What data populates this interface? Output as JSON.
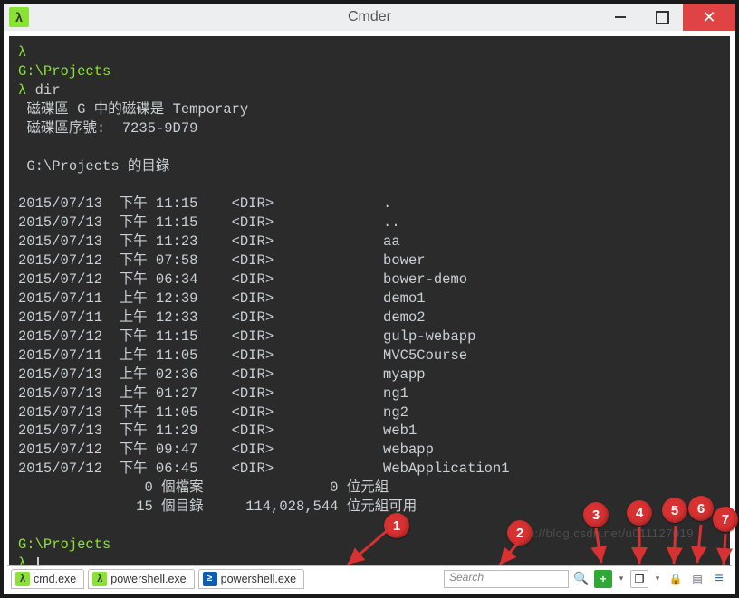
{
  "window": {
    "title": "Cmder"
  },
  "prompt": {
    "lambda": "λ",
    "path": "G:\\Projects",
    "cmd": "dir"
  },
  "vol": {
    "line1": "磁碟區 G 中的磁碟是 Temporary",
    "line2": "磁碟區序號:  7235-9D79"
  },
  "heading": "G:\\Projects 的目錄",
  "rows": [
    {
      "date": "2015/07/13",
      "time": "下午 11:15",
      "tag": "<DIR>",
      "name": "."
    },
    {
      "date": "2015/07/13",
      "time": "下午 11:15",
      "tag": "<DIR>",
      "name": ".."
    },
    {
      "date": "2015/07/13",
      "time": "下午 11:23",
      "tag": "<DIR>",
      "name": "aa"
    },
    {
      "date": "2015/07/12",
      "time": "下午 07:58",
      "tag": "<DIR>",
      "name": "bower"
    },
    {
      "date": "2015/07/12",
      "time": "下午 06:34",
      "tag": "<DIR>",
      "name": "bower-demo"
    },
    {
      "date": "2015/07/11",
      "time": "上午 12:39",
      "tag": "<DIR>",
      "name": "demo1"
    },
    {
      "date": "2015/07/11",
      "time": "上午 12:33",
      "tag": "<DIR>",
      "name": "demo2"
    },
    {
      "date": "2015/07/12",
      "time": "下午 11:15",
      "tag": "<DIR>",
      "name": "gulp-webapp"
    },
    {
      "date": "2015/07/11",
      "time": "上午 11:05",
      "tag": "<DIR>",
      "name": "MVC5Course"
    },
    {
      "date": "2015/07/13",
      "time": "上午 02:36",
      "tag": "<DIR>",
      "name": "myapp"
    },
    {
      "date": "2015/07/13",
      "time": "上午 01:27",
      "tag": "<DIR>",
      "name": "ng1"
    },
    {
      "date": "2015/07/13",
      "time": "下午 11:05",
      "tag": "<DIR>",
      "name": "ng2"
    },
    {
      "date": "2015/07/13",
      "time": "下午 11:29",
      "tag": "<DIR>",
      "name": "web1"
    },
    {
      "date": "2015/07/12",
      "time": "下午 09:47",
      "tag": "<DIR>",
      "name": "webapp"
    },
    {
      "date": "2015/07/12",
      "time": "下午 06:45",
      "tag": "<DIR>",
      "name": "WebApplication1"
    }
  ],
  "summary": {
    "files": "               0 個檔案               0 位元組",
    "dirs": "              15 個目錄     114,028,544 位元組可用"
  },
  "tabs": [
    {
      "icon": "lam",
      "label": "cmd.exe"
    },
    {
      "icon": "lam",
      "label": "powershell.exe"
    },
    {
      "icon": "ps",
      "label": "powershell.exe"
    }
  ],
  "search": {
    "placeholder": "Search"
  },
  "icons": {
    "magnify": "🔍",
    "plus": "+",
    "dd": "▾",
    "window": "❐",
    "lock": "🔒",
    "notes": "▤",
    "menu": "≡",
    "close": "✕"
  },
  "watermark": "http://blog.csdn.net/u011127019",
  "callouts": [
    "1",
    "2",
    "3",
    "4",
    "5",
    "6",
    "7"
  ]
}
